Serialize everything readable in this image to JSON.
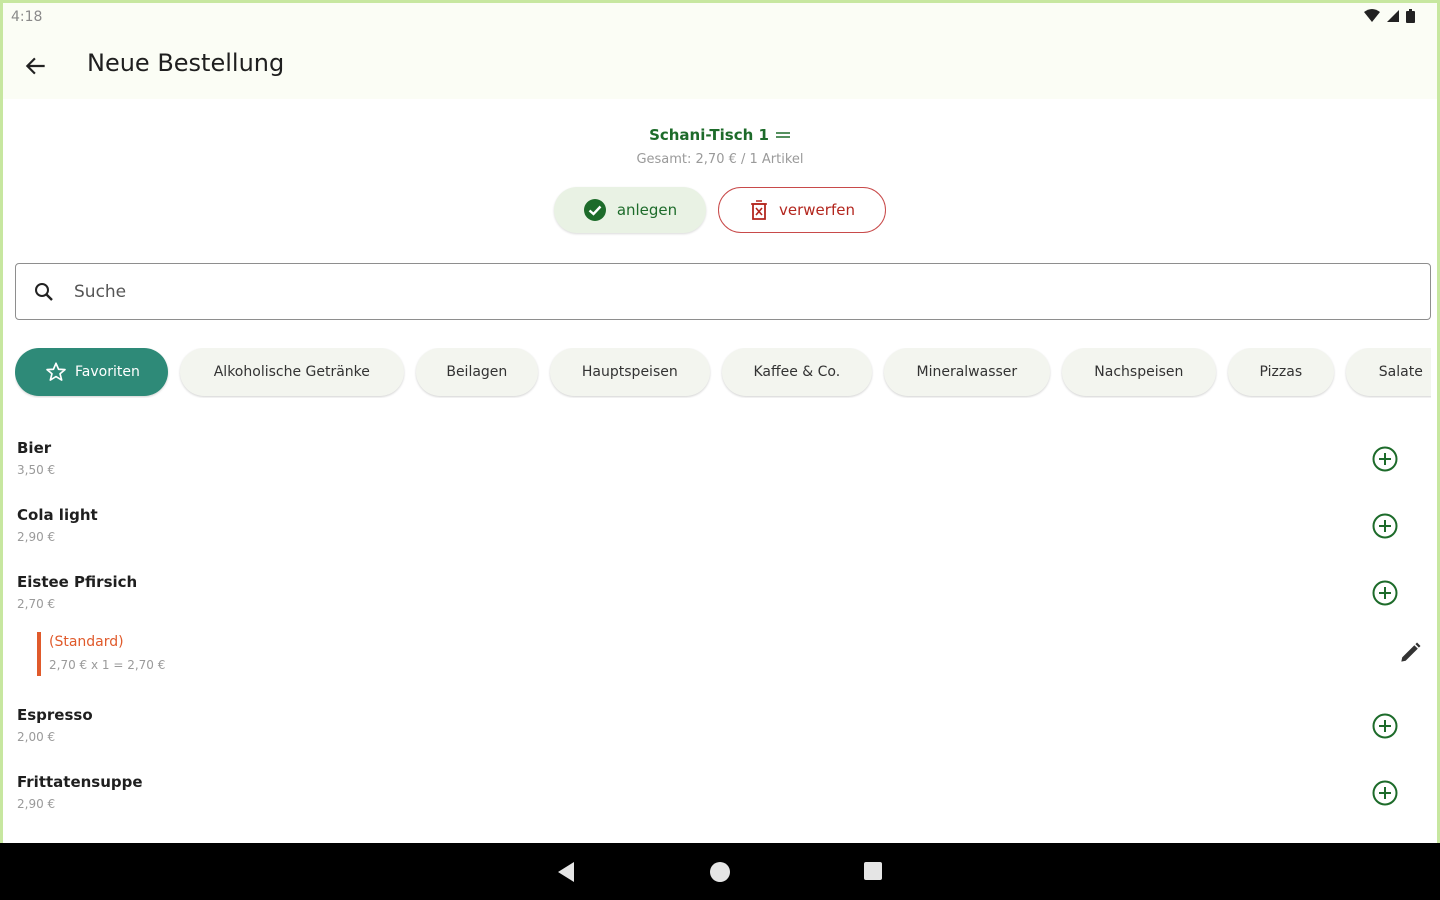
{
  "status_bar": {
    "time": "4:18"
  },
  "app_bar": {
    "title": "Neue Bestellung"
  },
  "order": {
    "table_name": "Schani-Tisch 1",
    "summary": "Gesamt: 2,70 € / 1 Artikel"
  },
  "actions": {
    "create_label": "anlegen",
    "discard_label": "verwerfen"
  },
  "search": {
    "placeholder": "Suche",
    "value": ""
  },
  "categories": [
    {
      "label": "Favoriten",
      "selected": true
    },
    {
      "label": "Alkoholische Getränke",
      "selected": false
    },
    {
      "label": "Beilagen",
      "selected": false
    },
    {
      "label": "Hauptspeisen",
      "selected": false
    },
    {
      "label": "Kaffee & Co.",
      "selected": false
    },
    {
      "label": "Mineralwasser",
      "selected": false
    },
    {
      "label": "Nachspeisen",
      "selected": false
    },
    {
      "label": "Pizzas",
      "selected": false
    },
    {
      "label": "Salate",
      "selected": false
    }
  ],
  "products": [
    {
      "name": "Bier",
      "price": "3,50 €"
    },
    {
      "name": "Cola light",
      "price": "2,90 €"
    },
    {
      "name": "Eistee Pfirsich",
      "price": "2,70 €"
    },
    {
      "name": "Espresso",
      "price": "2,00 €"
    },
    {
      "name": "Frittatensuppe",
      "price": "2,90 €"
    }
  ],
  "order_line": {
    "variant": "(Standard)",
    "detail": "2,70 € x 1 = 2,70 €"
  },
  "colors": {
    "accent": "#1d6b2a",
    "chip_active": "#2e8a78",
    "danger": "#b3261e",
    "variant": "#e05a2b"
  }
}
